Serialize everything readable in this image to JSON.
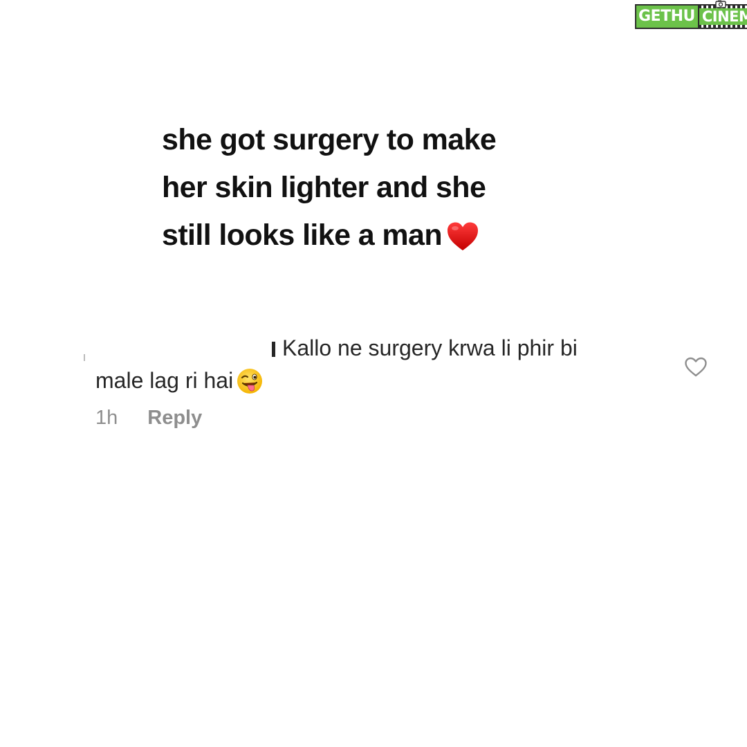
{
  "watermark": {
    "left_text": "GETHU",
    "right_text": "CINEMA",
    "brand_color": "#6cc24a"
  },
  "caption": {
    "lines": [
      "she got surgery to make",
      "her skin lighter and she",
      "still looks like a man"
    ],
    "end_icon": "red-heart-emoji"
  },
  "comment": {
    "line1": "Kallo ne surgery krwa li phir bi",
    "line2": "male lag ri hai",
    "end_icon": "winking-face-with-tongue-emoji",
    "time": "1h",
    "reply_label": "Reply",
    "like_icon": "heart-outline-icon"
  }
}
